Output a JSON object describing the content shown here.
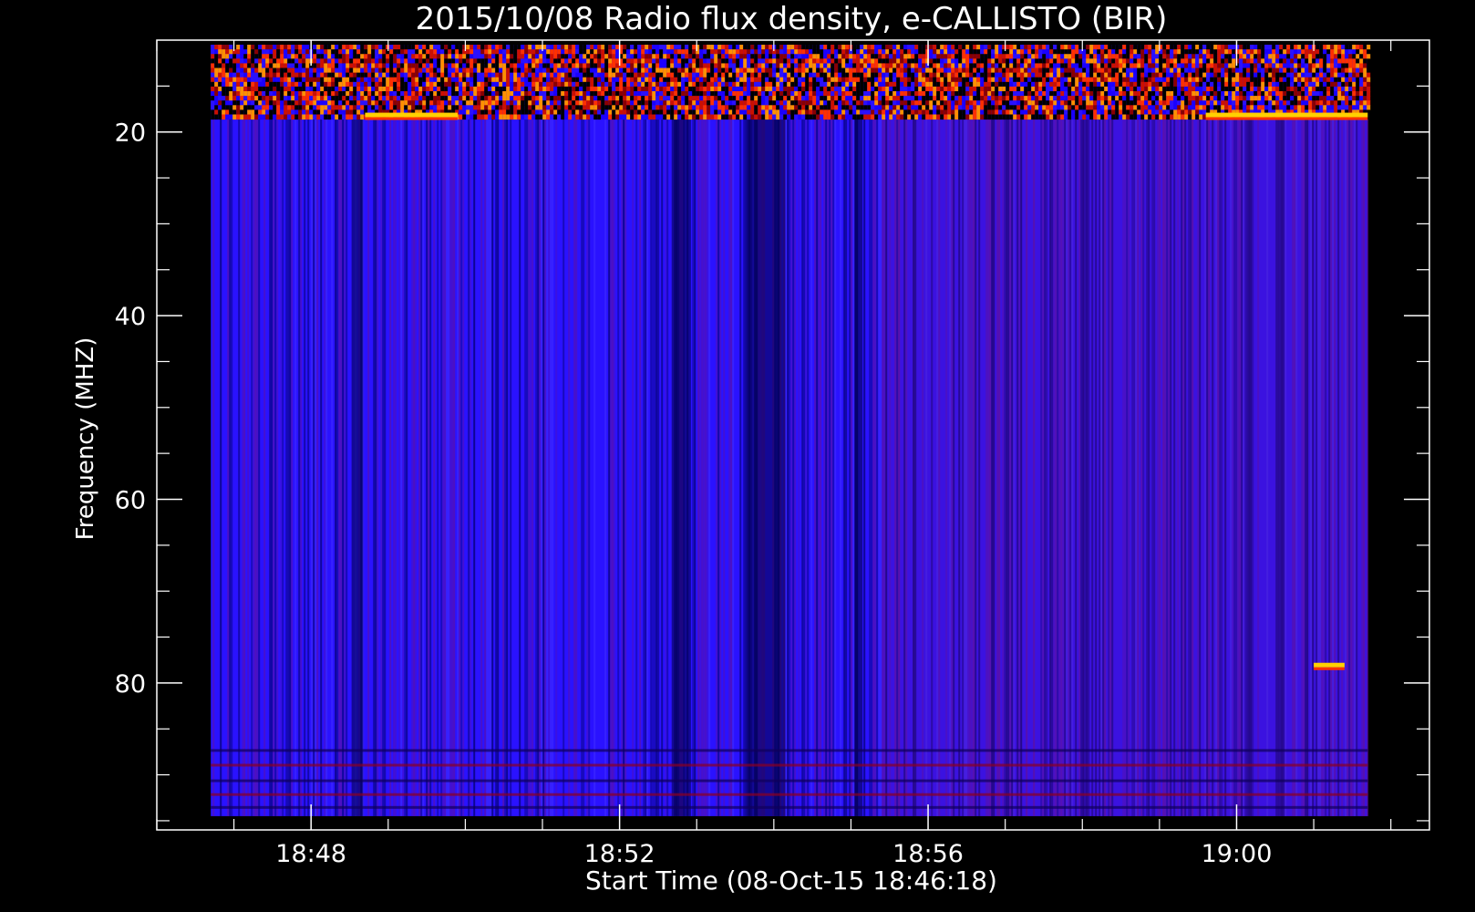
{
  "chart_data": {
    "type": "heatmap",
    "title": "2015/10/08  Radio flux density, e-CALLISTO (BIR)",
    "xlabel": "Start Time (08-Oct-15 18:46:18)",
    "ylabel": "Frequency (MHZ)",
    "x_ticks": [
      {
        "label": "18:48",
        "minutes": 48
      },
      {
        "label": "18:52",
        "minutes": 52
      },
      {
        "label": "18:56",
        "minutes": 56
      },
      {
        "label": "19:00",
        "minutes": 60
      }
    ],
    "y_ticks": [
      {
        "label": "20",
        "value": 20
      },
      {
        "label": "40",
        "value": 40
      },
      {
        "label": "60",
        "value": 60
      },
      {
        "label": "80",
        "value": 80
      }
    ],
    "xlim_minutes": [
      46,
      62.5
    ],
    "ylim_mhz": [
      10,
      96
    ],
    "data_time_range_minutes": [
      46.7,
      61.7
    ],
    "data_freq_range_mhz": [
      10.5,
      94.5
    ],
    "y_axis_inverted": true,
    "colormap": [
      "#000000",
      "#1a00ff",
      "#2a10ff",
      "#8a0000",
      "#ff2000",
      "#ffd000"
    ],
    "colors": {
      "background": "#000000",
      "axis": "#ffffff",
      "base": "#2a12ff"
    },
    "bright_bursts": [
      {
        "time_start": 48.7,
        "time_end": 49.9,
        "freq_mhz": 18.1
      },
      {
        "time_start": 59.6,
        "time_end": 61.7,
        "freq_mhz": 18.1
      },
      {
        "time_start": 61.0,
        "time_end": 61.4,
        "freq_mhz": 78.0
      }
    ],
    "dark_columns": [
      {
        "time": 48.6,
        "width": 0.15
      },
      {
        "time": 52.8,
        "width": 0.25
      },
      {
        "time": 53.9,
        "width": 0.5
      },
      {
        "time": 55.1,
        "width": 0.1
      }
    ],
    "grid": false
  }
}
